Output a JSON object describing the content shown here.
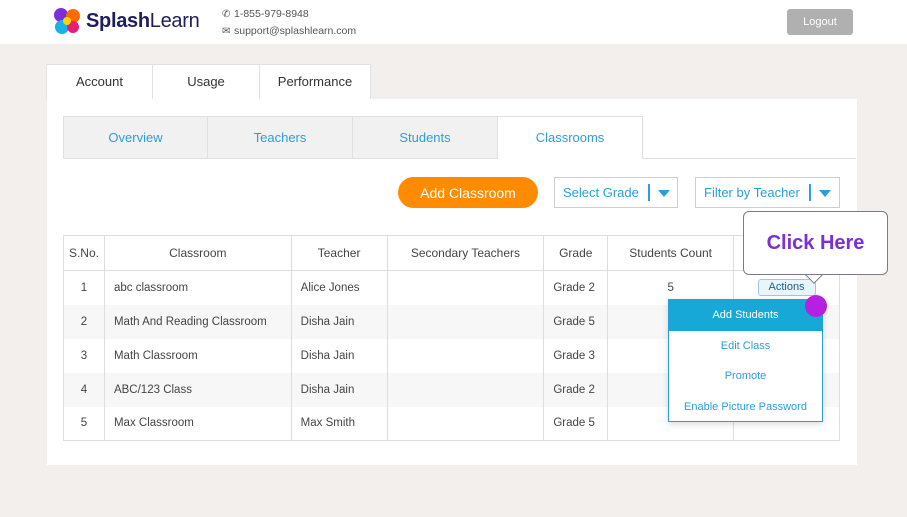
{
  "header": {
    "brand": {
      "bold": "Splash",
      "thin": "Learn"
    },
    "phone": "1-855-979-8948",
    "email": "support@splashlearn.com",
    "logout_label": "Logout"
  },
  "top_tabs": [
    {
      "label": "Account"
    },
    {
      "label": "Usage"
    },
    {
      "label": "Performance"
    }
  ],
  "sub_tabs": [
    {
      "label": "Overview"
    },
    {
      "label": "Teachers"
    },
    {
      "label": "Students"
    },
    {
      "label": "Classrooms",
      "active": true
    }
  ],
  "controls": {
    "add_classroom_label": "Add Classroom",
    "select_grade_label": "Select Grade",
    "filter_teacher_label": "Filter by Teacher"
  },
  "table": {
    "headers": [
      "S.No.",
      "Classroom",
      "Teacher",
      "Secondary Teachers",
      "Grade",
      "Students Count",
      ""
    ],
    "rows": [
      {
        "sno": "1",
        "classroom": "abc classroom",
        "teacher": "Alice Jones",
        "secondary": "",
        "grade": "Grade 2",
        "count": "5",
        "action": "Actions"
      },
      {
        "sno": "2",
        "classroom": "Math And Reading Classroom",
        "teacher": "Disha Jain",
        "secondary": "",
        "grade": "Grade 5",
        "count": "",
        "action": ""
      },
      {
        "sno": "3",
        "classroom": "Math Classroom",
        "teacher": "Disha Jain",
        "secondary": "",
        "grade": "Grade 3",
        "count": "",
        "action": ""
      },
      {
        "sno": "4",
        "classroom": "ABC/123 Class",
        "teacher": "Disha Jain",
        "secondary": "",
        "grade": "Grade 2",
        "count": "",
        "action": ""
      },
      {
        "sno": "5",
        "classroom": "Max Classroom",
        "teacher": "Max Smith",
        "secondary": "",
        "grade": "Grade 5",
        "count": "",
        "action": ""
      }
    ]
  },
  "actions_menu": [
    {
      "label": "Add Students",
      "active": true
    },
    {
      "label": "Edit Class"
    },
    {
      "label": "Promote"
    },
    {
      "label": "Enable Picture Password"
    }
  ],
  "tooltip": {
    "text": "Click Here"
  },
  "colors": {
    "accent_orange": "#ff8c00",
    "link_blue": "#2d9ed8",
    "highlight_purple": "#b620e0"
  }
}
